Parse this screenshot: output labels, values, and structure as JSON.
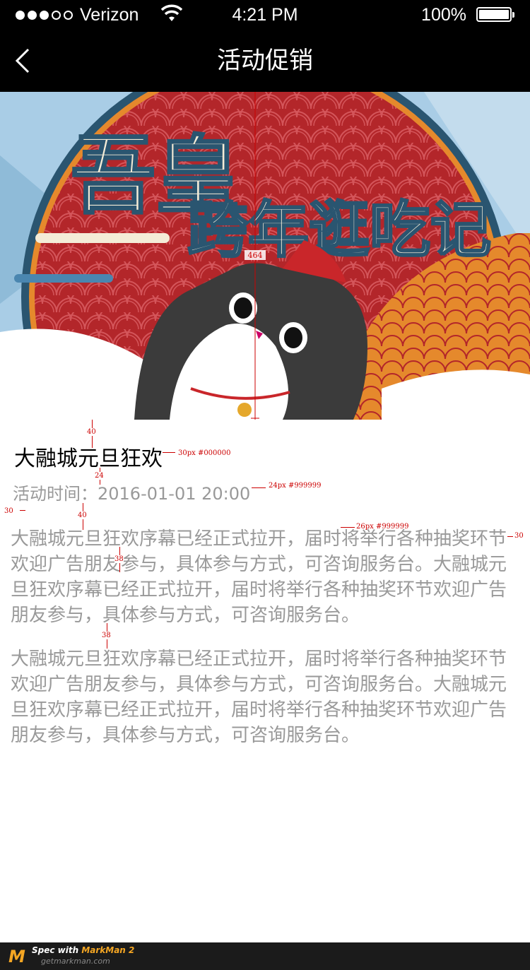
{
  "status_bar": {
    "carrier": "Verizon",
    "time": "4:21 PM",
    "battery": "100%"
  },
  "nav": {
    "title": "活动促销"
  },
  "banner": {
    "headline_top": "吾皇",
    "headline_bottom": "跨年逛吃记",
    "dimension_label": "464"
  },
  "event": {
    "title": "大融城元旦狂欢",
    "time_label": "活动时间：",
    "time_value": "2016-01-01 20:00"
  },
  "content": {
    "paragraph_1": "大融城元旦狂欢序幕已经正式拉开，届时将举行各种抽奖环节欢迎广告朋友参与，具体参与方式，可咨询服务台。大融城元旦狂欢序幕已经正式拉开，届时将举行各种抽奖环节欢迎广告朋友参与，具体参与方式，可咨询服务台。",
    "paragraph_2": "大融城元旦狂欢序幕已经正式拉开，届时将举行各种抽奖环节欢迎广告朋友参与，具体参与方式，可咨询服务台。大融城元旦狂欢序幕已经正式拉开，届时将举行各种抽奖环节欢迎广告朋友参与，具体参与方式，可咨询服务台。"
  },
  "annotations": {
    "gap_banner_title": "40",
    "title_spec": "30px #000000",
    "gap_title_time": "24",
    "time_spec": "24px #999999",
    "left_margin": "30",
    "gap_time_body": "40",
    "body_spec": "26px #999999",
    "right_margin": "30",
    "line_gap": "38",
    "para_gap": "38"
  },
  "footer": {
    "logo_letter": "M",
    "spec_prefix": "Spec with ",
    "spec_brand": "MarkMan 2",
    "url": "getmarkman.com"
  },
  "colors": {
    "banner_red": "#b3262a",
    "banner_sky": "#a9cde6",
    "banner_orange": "#e5892c",
    "spec_red": "#cc0000"
  }
}
